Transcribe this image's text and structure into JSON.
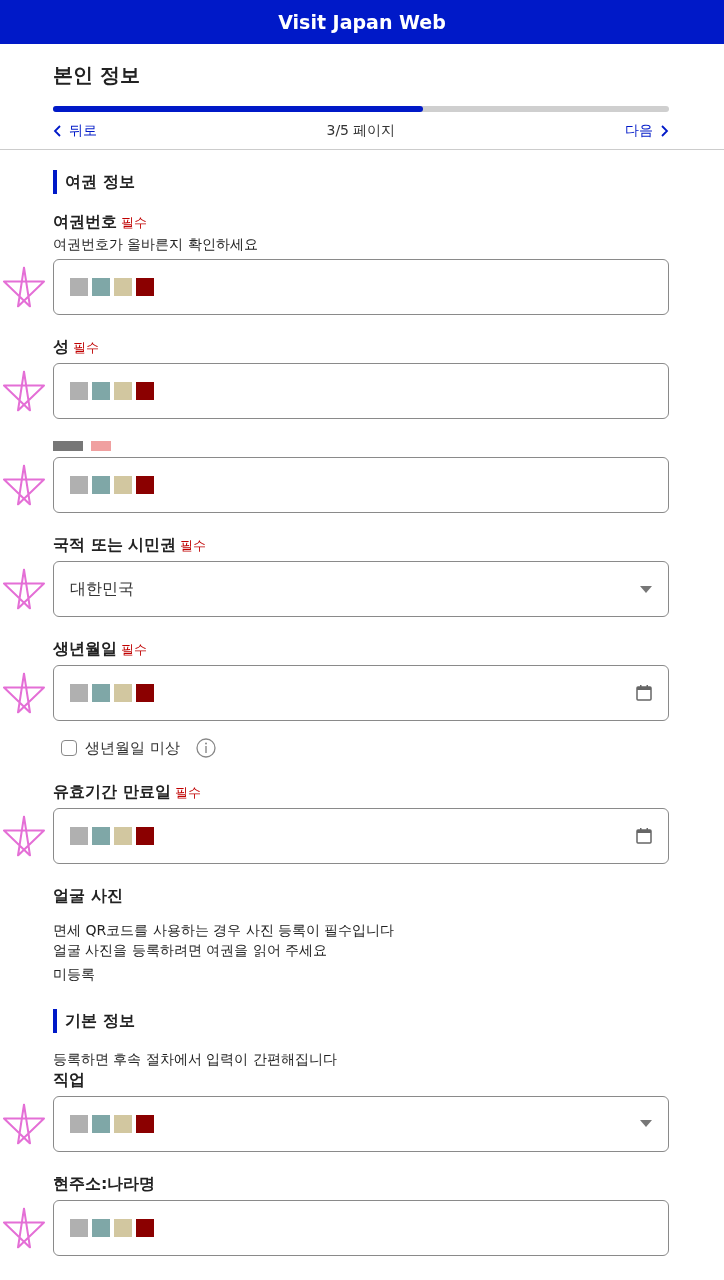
{
  "header": {
    "title": "Visit Japan Web"
  },
  "page": {
    "title": "본인 정보",
    "progress": {
      "level": 0.6
    },
    "back": "뒤로",
    "counter": "3/5 페이지",
    "next": "다음"
  },
  "sections": [
    {
      "title": "여권 정보",
      "items": [
        {
          "kind": "text",
          "label": "여권번호",
          "required": "필수",
          "help": "여권번호가 올바른지 확인하세요",
          "redacted": true,
          "starred": true
        },
        {
          "kind": "text",
          "label": "성",
          "required": "필수",
          "redacted": true,
          "starred": true
        },
        {
          "kind": "text",
          "label_redacted": true,
          "redacted": true,
          "starred": true
        },
        {
          "kind": "select",
          "label": "국적 또는 시민권",
          "required": "필수",
          "value": "대한민국",
          "redacted": false,
          "starred": true
        },
        {
          "kind": "date",
          "label": "생년월일",
          "required": "필수",
          "redacted": true,
          "starred": true,
          "checkbox": {
            "label": "생년월일 미상",
            "checked": false
          }
        },
        {
          "kind": "date",
          "label": "유효기간 만료일",
          "required": "필수",
          "redacted": true,
          "starred": true
        },
        {
          "kind": "info",
          "label": "얼굴 사진",
          "lines": [
            "면세 QR코드를 사용하는 경우 사진 등록이 필수입니다",
            "얼굴 사진을 등록하려면 여권을 읽어 주세요"
          ],
          "status": "미등록"
        }
      ]
    },
    {
      "title": "기본 정보",
      "help": "등록하면 후속 절차에서 입력이 간편해집니다",
      "items": [
        {
          "kind": "select",
          "label": "직업",
          "redacted": true,
          "starred": true
        },
        {
          "kind": "text",
          "label": "현주소:나라명",
          "redacted": true,
          "starred": true
        }
      ]
    }
  ]
}
